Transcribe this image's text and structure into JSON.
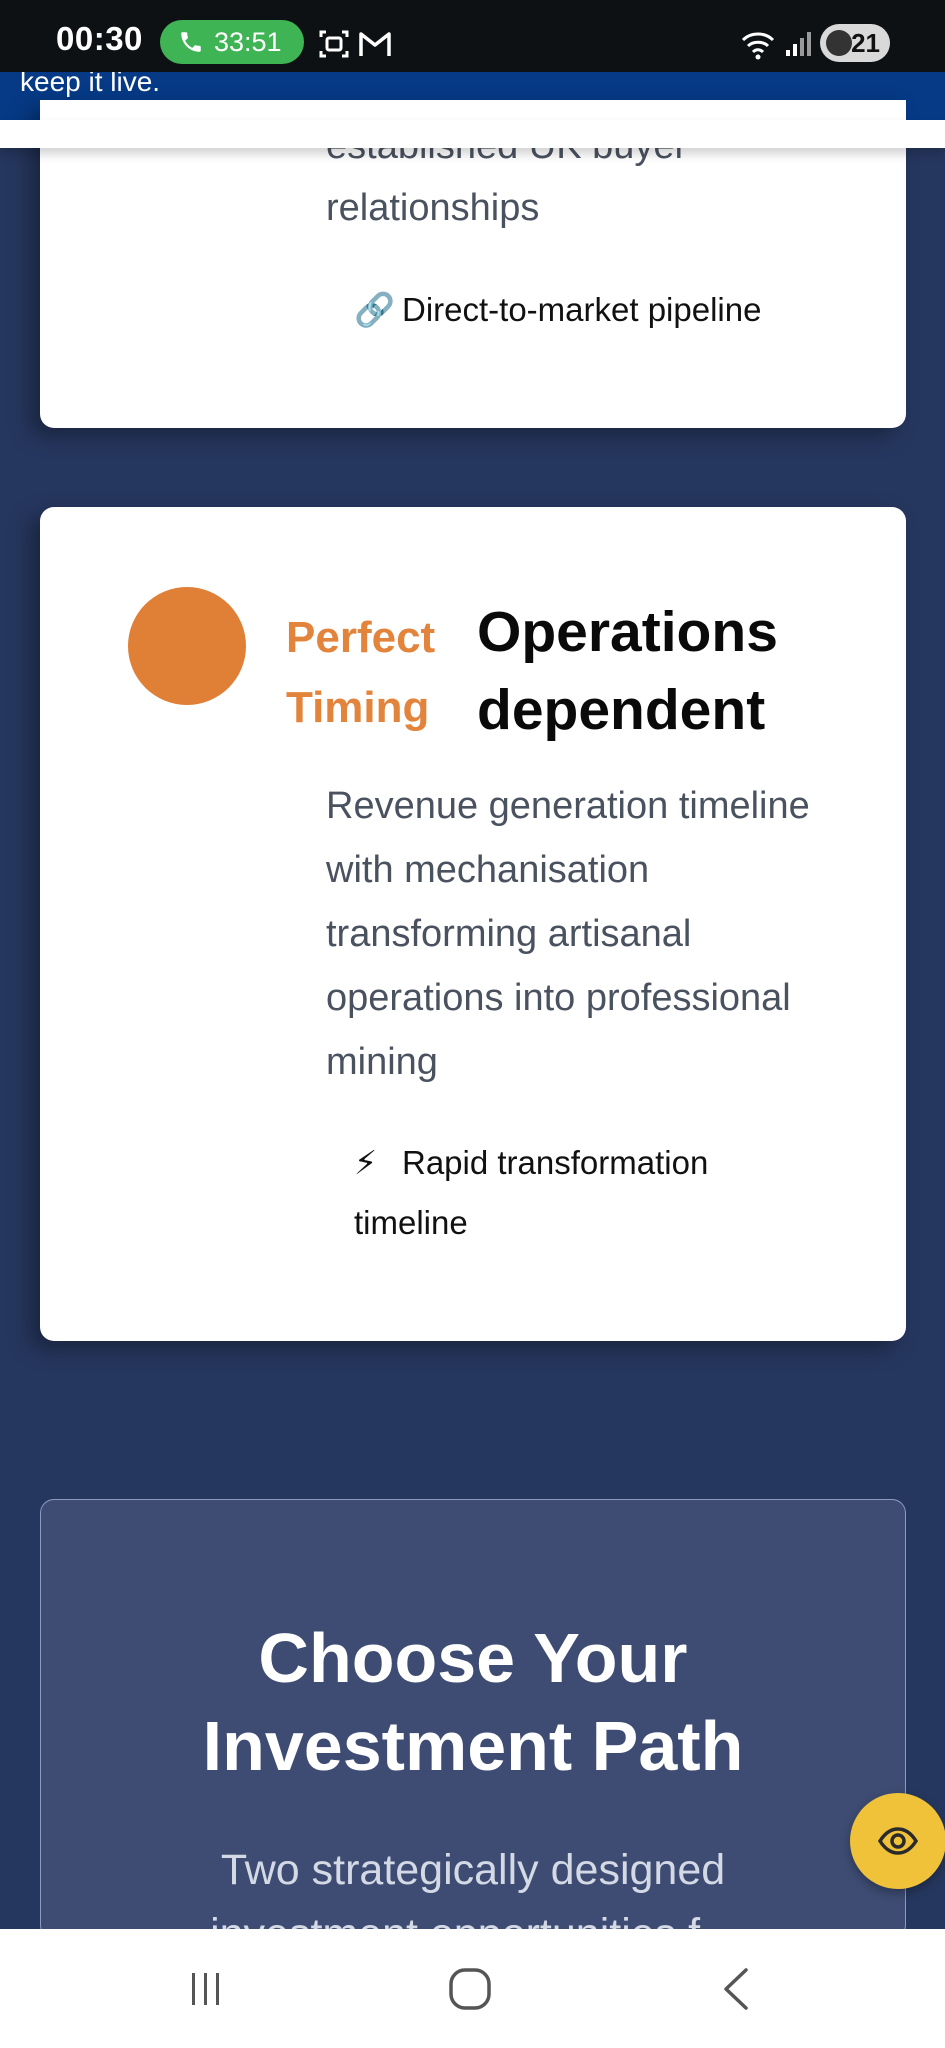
{
  "status_bar": {
    "time": "00:30",
    "call_duration": "33:51",
    "battery": "21",
    "icons": [
      "phone-icon",
      "screenshot-icon",
      "gmail-icon",
      "wifi-icon",
      "signal-icon",
      "battery-saver-icon"
    ]
  },
  "header": {
    "partial_text": "keep it live."
  },
  "card1": {
    "desc_line_partial": "established UK buyer",
    "desc_line": "relationships",
    "feature_emoji": "🔗",
    "feature_text": "Direct-to-market pipeline"
  },
  "card2": {
    "label_line1": "Perfect",
    "label_line2": "Timing",
    "title_line1": "Operations",
    "title_line2": "dependent",
    "desc_lines": [
      "Revenue generation timeline",
      "with mechanisation",
      "transforming artisanal",
      "operations into professional",
      "mining"
    ],
    "feature_emoji": "⚡",
    "feature_line1": "Rapid transformation",
    "feature_line2": "timeline",
    "accent_color": "#e07f36"
  },
  "investment": {
    "title_line1": "Choose Your",
    "title_line2": "Investment Path",
    "subtitle_line1": "Two strategically designed",
    "subtitle_line2": "investment opportunities f..."
  },
  "fab": {
    "icon": "eye-icon",
    "color": "#f0c23a"
  },
  "nav": {
    "buttons": [
      "recents-button",
      "home-button",
      "back-button"
    ]
  }
}
